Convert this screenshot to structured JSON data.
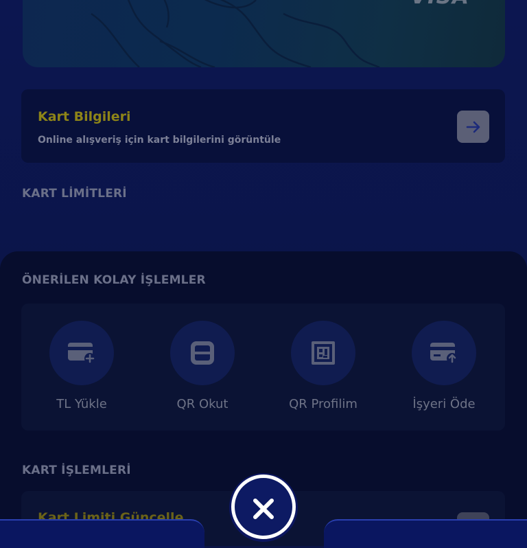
{
  "card": {
    "brand": "VISA"
  },
  "card_info": {
    "title": "Kart Bilgileri",
    "description": "Online alışveriş için kart bilgilerini görüntüle",
    "arrow_icon": "arrow-right-icon"
  },
  "sections": {
    "limits": "KART LİMİTLERİ",
    "suggested": "ÖNERİLEN KOLAY İŞLEMLER",
    "card_ops": "KART İŞLEMLERİ"
  },
  "quick_actions": [
    {
      "label": "TL Yükle",
      "icon": "card-add-icon"
    },
    {
      "label": "QR Okut",
      "icon": "qr-scan-icon"
    },
    {
      "label": "QR Profilim",
      "icon": "qr-code-icon"
    },
    {
      "label": "İşyeri Öde",
      "icon": "card-pay-icon"
    }
  ],
  "card_ops_items": [
    {
      "title": "Kart Limiti Güncelle"
    }
  ],
  "fab": {
    "icon": "close-icon"
  },
  "colors": {
    "accent_yellow": "#8d8418",
    "background": "#0b1446",
    "sheet": "#070d2d"
  }
}
